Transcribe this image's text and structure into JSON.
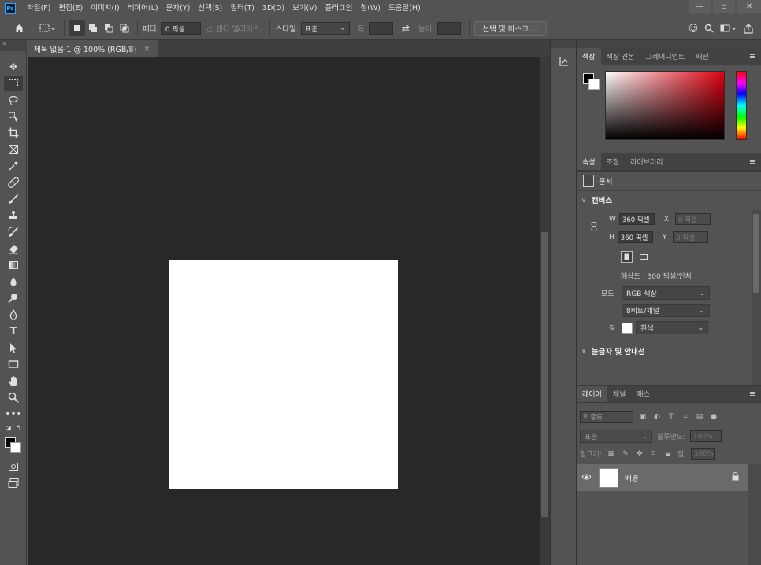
{
  "app": {
    "logo": "Ps"
  },
  "menu": [
    "파일(F)",
    "편집(E)",
    "이미지(I)",
    "레이어(L)",
    "문자(Y)",
    "선택(S)",
    "필터(T)",
    "3D(D)",
    "보기(V)",
    "플러그인",
    "창(W)",
    "도움말(H)"
  ],
  "window_controls": {
    "minimize": "—",
    "restore": "▫",
    "close": "✕"
  },
  "options": {
    "feather_label": "페더:",
    "feather_value": "0 픽셀",
    "antialias_label": "앤티 앨리어스",
    "style_label": "스타일:",
    "style_value": "표준",
    "width_label": "폭:",
    "height_label": "높이:",
    "select_mask_button": "선택 및 마스크 ..."
  },
  "document": {
    "tab_title": "제목 없음-1 @ 100% (RGB/8)",
    "tab_close": "×"
  },
  "color_panel": {
    "tabs": [
      "색상",
      "색상 견본",
      "그레이디언트",
      "패턴"
    ],
    "foreground": "#000000",
    "background": "#ffffff"
  },
  "properties_panel": {
    "tabs": [
      "속성",
      "조정",
      "라이브러리"
    ],
    "doc_label": "문서",
    "canvas_header": "캔버스",
    "w_label": "W",
    "w_value": "360 픽셀",
    "h_label": "H",
    "h_value": "360 픽셀",
    "x_label": "X",
    "x_placeholder": "0 픽셀",
    "y_label": "Y",
    "y_placeholder": "0 픽셀",
    "resolution": "해상도 : 300 픽셀/인치",
    "mode_label": "모드",
    "mode_value": "RGB 색상",
    "depth_value": "8비트/채널",
    "fill_label": "칠",
    "fill_value": "흰색",
    "rulers_header": "눈금자 및 안내선"
  },
  "layers_panel": {
    "tabs": [
      "레이어",
      "채널",
      "패스"
    ],
    "search_placeholder": "종류",
    "blend_mode": "표준",
    "opacity_label": "불투명도:",
    "opacity_value": "100%",
    "lock_label": "잠그기:",
    "fill_label": "칠:",
    "fill_value": "100%",
    "layers": [
      {
        "name": "배경",
        "visible": true,
        "locked": true
      }
    ]
  }
}
